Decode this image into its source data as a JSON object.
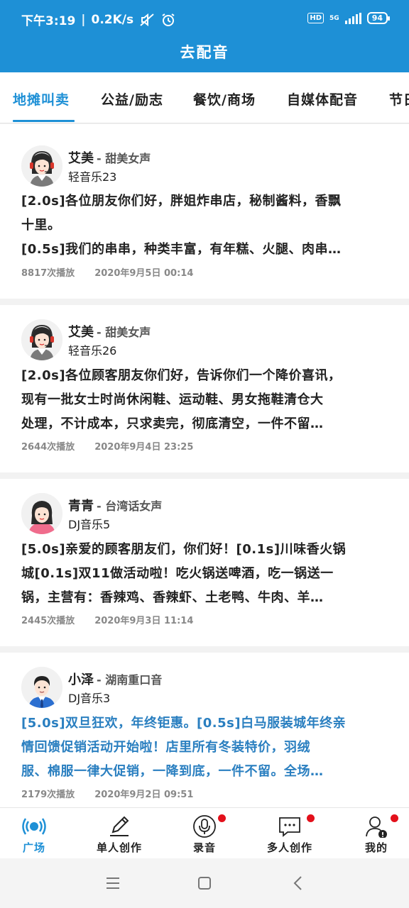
{
  "status_bar": {
    "time": "下午3:19",
    "speed": "0.2K/s",
    "hd": "HD",
    "network": "5G",
    "battery": "94"
  },
  "header": {
    "title": "去配音"
  },
  "tabs": [
    {
      "label": "地摊叫卖",
      "active": true
    },
    {
      "label": "公益/励志",
      "active": false
    },
    {
      "label": "餐饮/商场",
      "active": false
    },
    {
      "label": "自媒体配音",
      "active": false
    },
    {
      "label": "节日",
      "active": false
    }
  ],
  "cards": [
    {
      "name": "艾美",
      "voice": "- 甜美女声",
      "music": "轻音乐23",
      "avatar": "female-headset-avatar",
      "lines": [
        "[2.0s]各位朋友你们好，胖姐炸串店，秘制酱料，香飘",
        "十里。",
        "[0.5s]我们的串串，种类丰富，有年糕、火腿、肉串…"
      ],
      "plays": "8817次播放",
      "date": "2020年9月5日  00:14",
      "highlight": false
    },
    {
      "name": "艾美",
      "voice": "- 甜美女声",
      "music": "轻音乐26",
      "avatar": "female-headset-avatar",
      "lines": [
        "[2.0s]各位顾客朋友你们好，告诉你们一个降价喜讯，",
        "现有一批女士时尚休闲鞋、运动鞋、男女拖鞋清仓大",
        "处理，不计成本，只求卖完，彻底清空，一件不留…"
      ],
      "plays": "2644次播放",
      "date": "2020年9月4日  23:25",
      "highlight": false
    },
    {
      "name": "青青",
      "voice": "- 台湾话女声",
      "music": "DJ音乐5",
      "avatar": "female-pink-avatar",
      "lines": [
        "[5.0s]亲爱的顾客朋友们，你们好！[0.1s]川味香火锅",
        "城[0.1s]双11做活动啦！吃火锅送啤酒，吃一锅送一",
        "锅，主营有：香辣鸡、香辣虾、土老鸭、牛肉、羊…"
      ],
      "plays": "2445次播放",
      "date": "2020年9月3日  11:14",
      "highlight": false
    },
    {
      "name": "小泽",
      "voice": "- 湖南重口音",
      "music": "DJ音乐3",
      "avatar": "male-suit-avatar",
      "lines": [
        "[5.0s]双旦狂欢，年终钜惠。[0.5s]白马服装城年终亲",
        "情回馈促销活动开始啦！店里所有冬装特价，羽绒",
        "服、棉服一律大促销，一降到底，一件不留。全场…"
      ],
      "plays": "2179次播放",
      "date": "2020年9月2日  09:51",
      "highlight": true
    }
  ],
  "bottom_nav": [
    {
      "label": "广场",
      "icon": "broadcast-icon",
      "active": true,
      "badge": false
    },
    {
      "label": "单人创作",
      "icon": "pencil-icon",
      "active": false,
      "badge": false
    },
    {
      "label": "录音",
      "icon": "microphone-icon",
      "active": false,
      "badge": true
    },
    {
      "label": "多人创作",
      "icon": "chat-bubble-icon",
      "active": false,
      "badge": true
    },
    {
      "label": "我的",
      "icon": "user-icon",
      "active": false,
      "badge": true
    }
  ],
  "colors": {
    "brand": "#1e90d6",
    "highlight_text": "#2a7fc0",
    "badge": "#e3101b"
  }
}
